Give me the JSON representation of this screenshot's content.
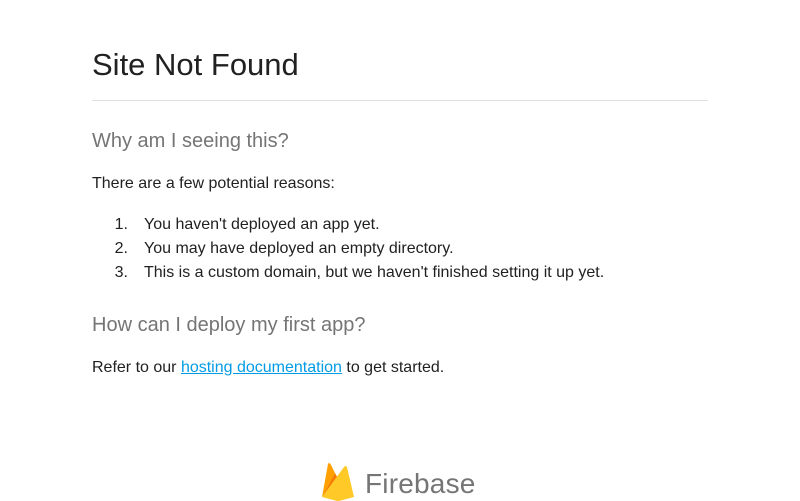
{
  "page": {
    "title": "Site Not Found",
    "why_heading": "Why am I seeing this?",
    "intro": "There are a few potential reasons:",
    "reasons": [
      {
        "num": "1.",
        "text": "You haven't deployed an app yet."
      },
      {
        "num": "2.",
        "text": "You may have deployed an empty directory."
      },
      {
        "num": "3.",
        "text": "This is a custom domain, but we haven't finished setting it up yet."
      }
    ],
    "how_heading": "How can I deploy my first app?",
    "refer_prefix": "Refer to our ",
    "refer_link": "hosting documentation",
    "refer_suffix": " to get started."
  },
  "footer": {
    "brand_name": "Firebase",
    "logo_icon": "firebase-flame-icon"
  },
  "colors": {
    "text": "#212121",
    "heading_muted": "#757575",
    "link": "#039be5",
    "divider": "#e0e0e0",
    "flame_yellow": "#ffca28",
    "flame_amber": "#ffa000",
    "flame_orange": "#f57c00"
  }
}
